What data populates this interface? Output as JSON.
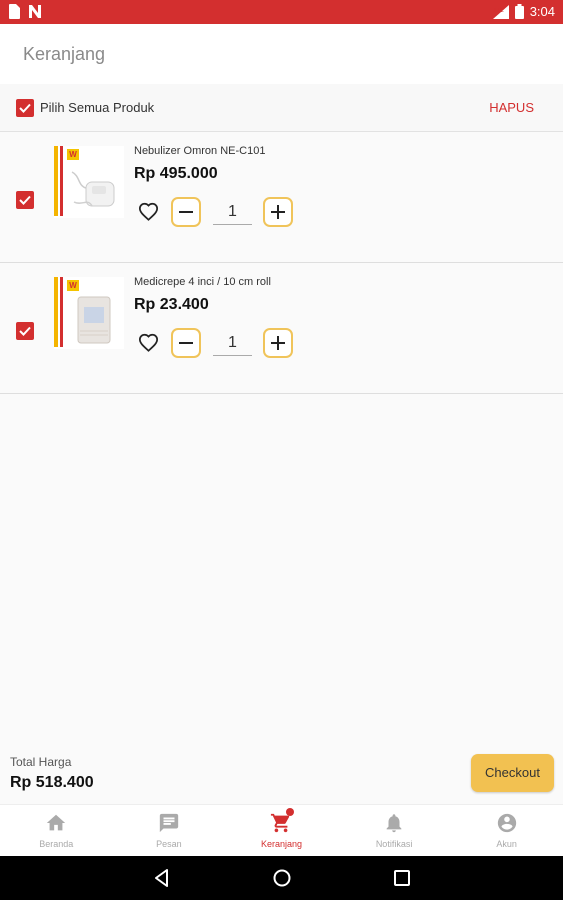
{
  "status_bar": {
    "time": "3:04",
    "network": "LTE"
  },
  "app_bar": {
    "title": "Keranjang"
  },
  "select_all": {
    "label": "Pilih Semua Produk",
    "delete_label": "HAPUS",
    "checked": true
  },
  "cart_items": [
    {
      "name": "Nebulizer Omron NE-C101",
      "price": "Rp 495.000",
      "quantity": "1",
      "checked": true,
      "logo_text": "W"
    },
    {
      "name": "Medicrepe 4 inci / 10 cm roll",
      "price": "Rp 23.400",
      "quantity": "1",
      "checked": true,
      "logo_text": "W"
    }
  ],
  "summary": {
    "total_label": "Total Harga",
    "total_value": "Rp 518.400",
    "checkout_label": "Checkout"
  },
  "bottom_nav": [
    {
      "label": "Beranda",
      "icon": "home-icon",
      "active": false
    },
    {
      "label": "Pesan",
      "icon": "message-icon",
      "active": false
    },
    {
      "label": "Keranjang",
      "icon": "cart-icon",
      "active": true
    },
    {
      "label": "Notifikasi",
      "icon": "bell-icon",
      "active": false
    },
    {
      "label": "Akun",
      "icon": "account-icon",
      "active": false
    }
  ],
  "colors": {
    "primary": "#d32f2f",
    "accent": "#f2c151",
    "stepper_border": "#f0c45a"
  }
}
